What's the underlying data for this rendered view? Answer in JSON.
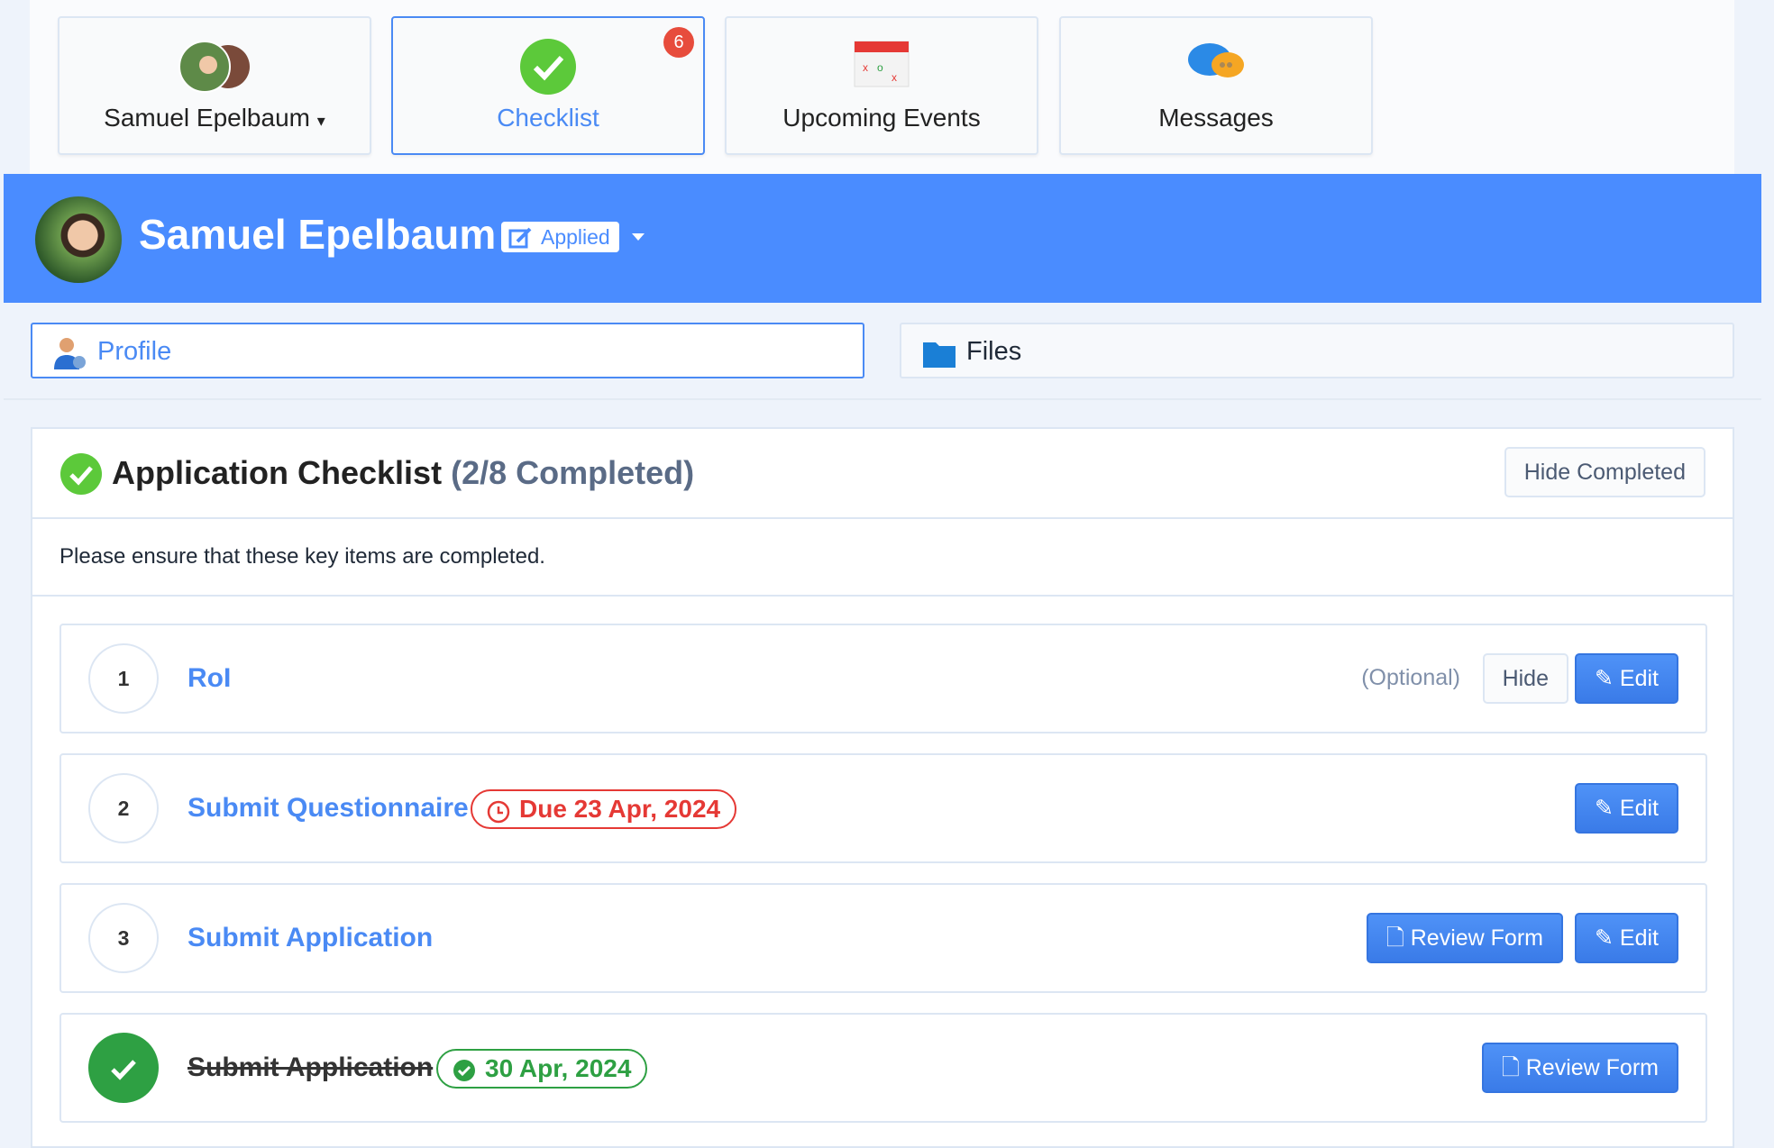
{
  "top_nav": [
    {
      "label": "Samuel Epelbaum",
      "icon": "family-avatars-icon",
      "dropdown": true
    },
    {
      "label": "Checklist",
      "icon": "green-check-icon",
      "badge": "6",
      "active": true
    },
    {
      "label": "Upcoming Events",
      "icon": "calendar-icon"
    },
    {
      "label": "Messages",
      "icon": "chat-bubbles-icon"
    }
  ],
  "header": {
    "name": "Samuel Epelbaum",
    "status": "Applied",
    "color": "#4a8cff"
  },
  "tabs": [
    {
      "label": "Profile",
      "icon": "user-gear-icon",
      "active": true
    },
    {
      "label": "Files",
      "icon": "folder-icon"
    }
  ],
  "checklist": {
    "title": "Application Checklist",
    "progress": "(2/8 Completed)",
    "hide_completed": "Hide Completed",
    "description": "Please ensure that these key items are completed.",
    "items": [
      {
        "num": "1",
        "title": "RoI",
        "optional": "(Optional)",
        "hide": "Hide",
        "edit": "Edit"
      },
      {
        "num": "2",
        "title": "Submit Questionnaire",
        "due": "Due 23 Apr, 2024",
        "edit": "Edit"
      },
      {
        "num": "3",
        "title": "Submit Application",
        "review": "Review Form",
        "edit": "Edit"
      },
      {
        "title": "Submit Application",
        "completed": "30 Apr, 2024",
        "review": "Review Form",
        "done": true
      }
    ]
  }
}
